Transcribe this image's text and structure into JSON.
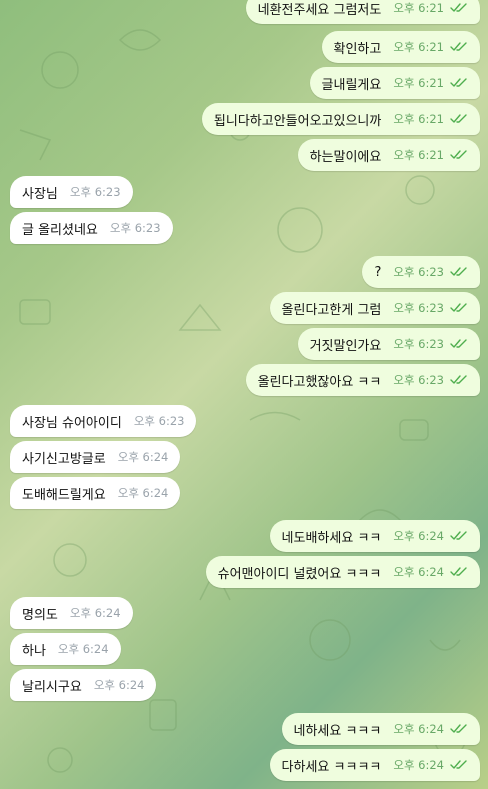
{
  "colors": {
    "incoming_bubble": "#ffffff",
    "outgoing_bubble": "#effdde",
    "read_ticks": "#4fae4e"
  },
  "messages": [
    {
      "dir": "out",
      "text": "네환전주세요 그럼저도",
      "time": "오후 6:21",
      "read": true
    },
    {
      "dir": "out",
      "text": "확인하고",
      "time": "오후 6:21",
      "read": true
    },
    {
      "dir": "out",
      "text": "글내릴게요",
      "time": "오후 6:21",
      "read": true
    },
    {
      "dir": "out",
      "text": "됩니다하고안들어오고있으니까",
      "time": "오후 6:21",
      "read": true
    },
    {
      "dir": "out",
      "text": "하는말이에요",
      "time": "오후 6:21",
      "read": true
    },
    {
      "dir": "in",
      "text": "사장님",
      "time": "오후 6:23"
    },
    {
      "dir": "in",
      "text": "글 올리셨네요",
      "time": "오후 6:23"
    },
    {
      "dir": "out",
      "text": "?",
      "time": "오후 6:23",
      "read": true
    },
    {
      "dir": "out",
      "text": "올린다고한게 그럼",
      "time": "오후 6:23",
      "read": true
    },
    {
      "dir": "out",
      "text": "거짓말인가요",
      "time": "오후 6:23",
      "read": true
    },
    {
      "dir": "out",
      "text": "올린다고했잖아요 ㅋㅋ",
      "time": "오후 6:23",
      "read": true
    },
    {
      "dir": "in",
      "text": "사장님 슈어아이디",
      "time": "오후 6:23"
    },
    {
      "dir": "in",
      "text": "사기신고방글로",
      "time": "오후 6:24"
    },
    {
      "dir": "in",
      "text": "도배해드릴게요",
      "time": "오후 6:24"
    },
    {
      "dir": "out",
      "text": "네도배하세요 ㅋㅋ",
      "time": "오후 6:24",
      "read": true
    },
    {
      "dir": "out",
      "text": "슈어맨아이디 널렸어요 ㅋㅋㅋ",
      "time": "오후 6:24",
      "read": true
    },
    {
      "dir": "in",
      "text": "명의도",
      "time": "오후 6:24"
    },
    {
      "dir": "in",
      "text": "하나",
      "time": "오후 6:24"
    },
    {
      "dir": "in",
      "text": "날리시구요",
      "time": "오후 6:24"
    },
    {
      "dir": "out",
      "text": "네하세요 ㅋㅋㅋ",
      "time": "오후 6:24",
      "read": true
    },
    {
      "dir": "out",
      "text": "다하세요 ㅋㅋㅋㅋ",
      "time": "오후 6:24",
      "read": true
    }
  ]
}
